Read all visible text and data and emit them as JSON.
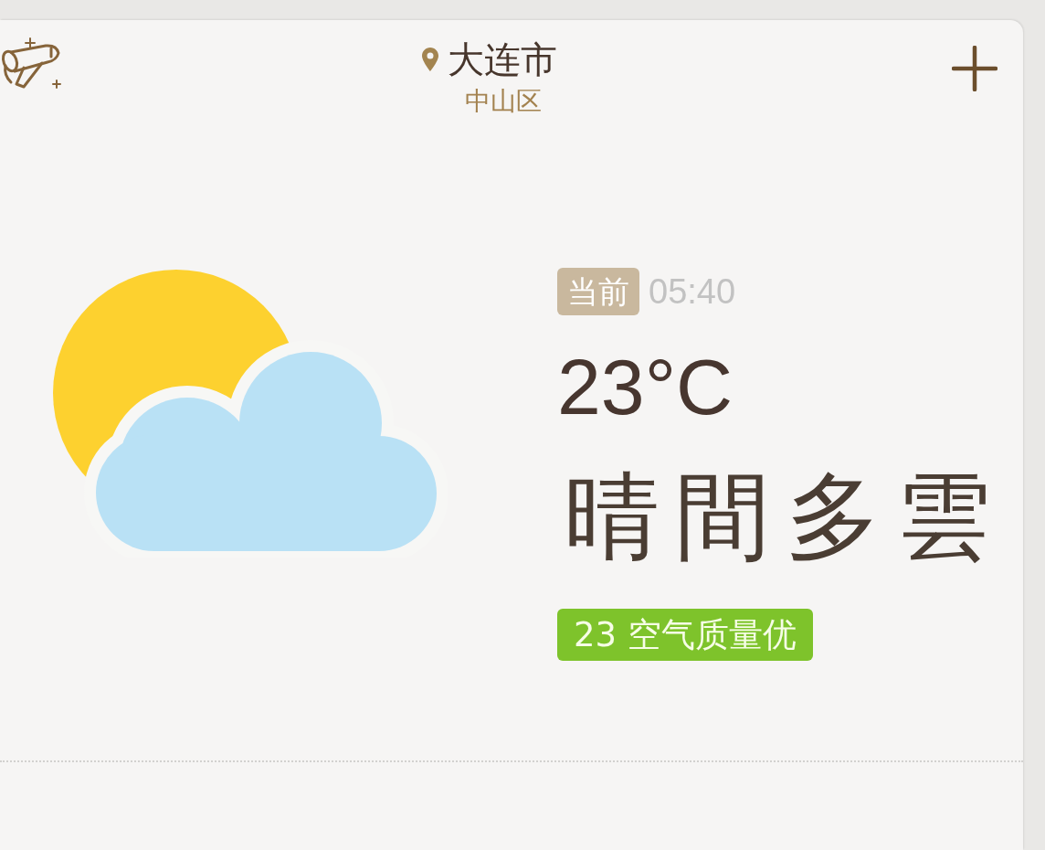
{
  "header": {
    "city": "大连市",
    "district": "中山区"
  },
  "current": {
    "badge": "当前",
    "time": "05:40",
    "temperature": "23°C",
    "condition": "晴間多雲",
    "air_quality": "23 空气质量优"
  }
}
